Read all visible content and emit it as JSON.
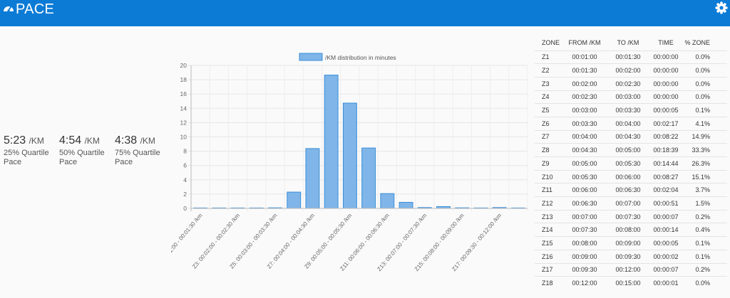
{
  "header": {
    "title": "PACE",
    "left_icon": "dashboard-gauge-icon",
    "right_icon": "gear-icon",
    "bar_color": "#0b7bd6"
  },
  "quartiles": [
    {
      "value": "5:23",
      "unit": "/KM",
      "label1": "25% Quartile",
      "label2": "Pace"
    },
    {
      "value": "4:54",
      "unit": "/KM",
      "label1": "50% Quartile",
      "label2": "Pace"
    },
    {
      "value": "4:38",
      "unit": "/KM",
      "label1": "75% Quartile",
      "label2": "Pace"
    }
  ],
  "chart_data": {
    "type": "bar",
    "legend": "/KM distribution in minutes",
    "legend_position": "top-center",
    "bar_color": "#7fb5e8",
    "bar_border": "#3a8fd9",
    "grid": true,
    "ylim": [
      0,
      20
    ],
    "yticks": [
      0,
      2,
      4,
      6,
      8,
      10,
      12,
      14,
      16,
      18,
      20
    ],
    "categories": [
      "Z1: 00:01:00 - 00:01:30 /km",
      "Z2: 00:01:30 - 00:02:00 /km",
      "Z3: 00:02:00 - 00:02:30 /km",
      "Z4: 00:02:30 - 00:03:00 /km",
      "Z5: 00:03:00 - 00:03:30 /km",
      "Z6: 00:03:30 - 00:04:00 /km",
      "Z7: 00:04:00 - 00:04:30 /km",
      "Z8: 00:04:30 - 00:05:00 /km",
      "Z9: 00:05:00 - 00:05:30 /km",
      "Z10: 00:05:30 - 00:06:00 /km",
      "Z11: 00:06:00 - 00:06:30 /km",
      "Z12: 00:06:30 - 00:07:00 /km",
      "Z13: 00:07:00 - 00:07:30 /km",
      "Z14: 00:07:30 - 00:08:00 /km",
      "Z15: 00:08:00 - 00:09:00 /km",
      "Z16: 00:09:00 - 00:09:30 /km",
      "Z17: 00:09:30 - 00:12:00 /km",
      "Z18: 00:12:00 - 00:15:00 /km"
    ],
    "values": [
      0,
      0,
      0,
      0,
      0.08,
      2.28,
      8.37,
      18.65,
      14.73,
      8.45,
      2.07,
      0.85,
      0.12,
      0.25,
      0.08,
      0.03,
      0.12,
      0.02
    ]
  },
  "zone_table": {
    "headers": [
      "ZONE",
      "FROM /KM",
      "TO /KM",
      "TIME",
      "% ZONE"
    ],
    "rows": [
      [
        "Z1",
        "00:01:00",
        "00:01:30",
        "00:00:00",
        "0.0%"
      ],
      [
        "Z2",
        "00:01:30",
        "00:02:00",
        "00:00:00",
        "0.0%"
      ],
      [
        "Z3",
        "00:02:00",
        "00:02:30",
        "00:00:00",
        "0.0%"
      ],
      [
        "Z4",
        "00:02:30",
        "00:03:00",
        "00:00:00",
        "0.0%"
      ],
      [
        "Z5",
        "00:03:00",
        "00:03:30",
        "00:00:05",
        "0.1%"
      ],
      [
        "Z6",
        "00:03:30",
        "00:04:00",
        "00:02:17",
        "4.1%"
      ],
      [
        "Z7",
        "00:04:00",
        "00:04:30",
        "00:08:22",
        "14.9%"
      ],
      [
        "Z8",
        "00:04:30",
        "00:05:00",
        "00:18:39",
        "33.3%"
      ],
      [
        "Z9",
        "00:05:00",
        "00:05:30",
        "00:14:44",
        "26.3%"
      ],
      [
        "Z10",
        "00:05:30",
        "00:06:00",
        "00:08:27",
        "15.1%"
      ],
      [
        "Z11",
        "00:06:00",
        "00:06:30",
        "00:02:04",
        "3.7%"
      ],
      [
        "Z12",
        "00:06:30",
        "00:07:00",
        "00:00:51",
        "1.5%"
      ],
      [
        "Z13",
        "00:07:00",
        "00:07:30",
        "00:00:07",
        "0.2%"
      ],
      [
        "Z14",
        "00:07:30",
        "00:08:00",
        "00:00:14",
        "0.4%"
      ],
      [
        "Z15",
        "00:08:00",
        "00:09:00",
        "00:00:05",
        "0.1%"
      ],
      [
        "Z16",
        "00:09:00",
        "00:09:30",
        "00:00:02",
        "0.1%"
      ],
      [
        "Z17",
        "00:09:30",
        "00:12:00",
        "00:00:07",
        "0.2%"
      ],
      [
        "Z18",
        "00:12:00",
        "00:15:00",
        "00:00:01",
        "0.0%"
      ]
    ]
  }
}
